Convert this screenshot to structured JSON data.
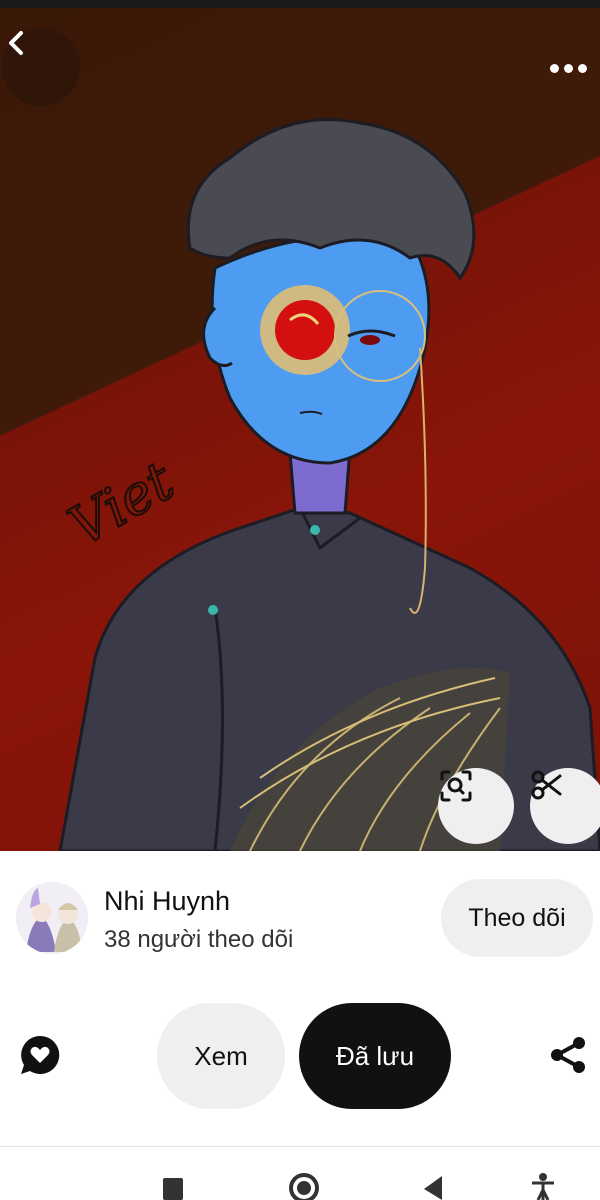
{
  "pin": {
    "image_label": "anime-style portrait artwork",
    "signature": "Viet"
  },
  "creator": {
    "name": "Nhi Huynh",
    "followers": "38 người theo dõi",
    "follow_label": "Theo dõi"
  },
  "actions": {
    "view_label": "Xem",
    "saved_label": "Đã lưu"
  },
  "icons": {
    "back": "chevron-left-icon",
    "more": "more-dots-icon",
    "lens": "visual-search-icon",
    "cut": "scissors-icon",
    "comment": "comment-heart-icon",
    "share": "share-icon",
    "nav_recents": "recents-square-icon",
    "nav_home": "home-circle-icon",
    "nav_back": "back-triangle-icon",
    "nav_accessibility": "accessibility-icon"
  },
  "colors": {
    "saved_button_bg": "#111111",
    "pill_bg": "#efefef",
    "background": "#ffffff"
  }
}
